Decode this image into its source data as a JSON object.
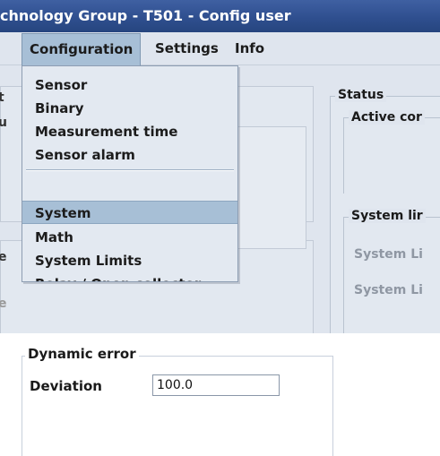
{
  "window": {
    "title": "chnology Group - T501 - Config user"
  },
  "menubar": {
    "items": [
      "Configuration",
      "Settings",
      "Info"
    ]
  },
  "dropdown": {
    "items": [
      "Sensor",
      "Binary",
      "Measurement time",
      "Sensor alarm",
      "System",
      "Math",
      "System Limits",
      "Relay / Open collector"
    ],
    "highlighted": "System"
  },
  "status_panel": {
    "title": "Status",
    "active_label": "Active cor",
    "system_limits_title": "System lir",
    "disabled_items": [
      "System Li",
      "System Li"
    ]
  },
  "left_edge_chars": [
    "t",
    "u",
    "e",
    "e"
  ],
  "dynamic_error": {
    "title": "Dynamic error",
    "deviation_label": "Deviation",
    "deviation_value": "100.0"
  },
  "colors": {
    "titlebar": "#2f4f8f",
    "menu_highlight": "#a7bfd6",
    "window_bg": "#dfe5ee"
  }
}
